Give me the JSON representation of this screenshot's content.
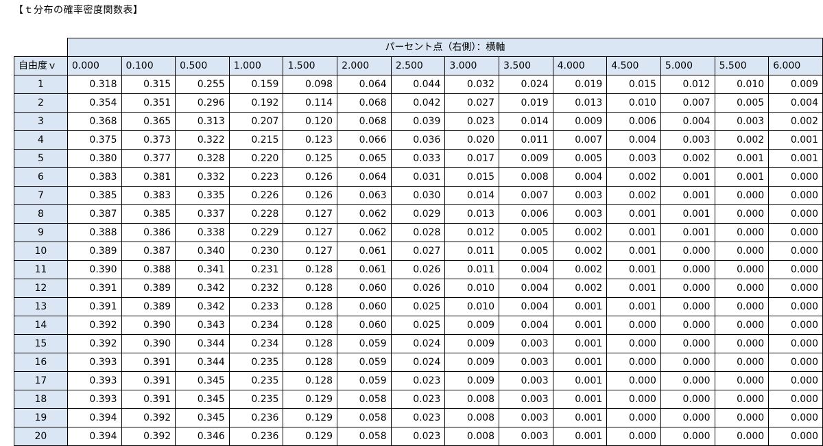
{
  "title": "【ｔ分布の確率密度関数表】",
  "table": {
    "header_span": "パーセント点（右側）：横軸",
    "row_header_label": "自由度ｖ",
    "columns": [
      "0.000",
      "0.100",
      "0.500",
      "1.000",
      "1.500",
      "2.000",
      "2.500",
      "3.000",
      "3.500",
      "4.000",
      "4.500",
      "5.000",
      "5.500",
      "6.000"
    ],
    "rows": [
      {
        "label": "1",
        "values": [
          "0.318",
          "0.315",
          "0.255",
          "0.159",
          "0.098",
          "0.064",
          "0.044",
          "0.032",
          "0.024",
          "0.019",
          "0.015",
          "0.012",
          "0.010",
          "0.009"
        ]
      },
      {
        "label": "2",
        "values": [
          "0.354",
          "0.351",
          "0.296",
          "0.192",
          "0.114",
          "0.068",
          "0.042",
          "0.027",
          "0.019",
          "0.013",
          "0.010",
          "0.007",
          "0.005",
          "0.004"
        ]
      },
      {
        "label": "3",
        "values": [
          "0.368",
          "0.365",
          "0.313",
          "0.207",
          "0.120",
          "0.068",
          "0.039",
          "0.023",
          "0.014",
          "0.009",
          "0.006",
          "0.004",
          "0.003",
          "0.002"
        ]
      },
      {
        "label": "4",
        "values": [
          "0.375",
          "0.373",
          "0.322",
          "0.215",
          "0.123",
          "0.066",
          "0.036",
          "0.020",
          "0.011",
          "0.007",
          "0.004",
          "0.003",
          "0.002",
          "0.001"
        ]
      },
      {
        "label": "5",
        "values": [
          "0.380",
          "0.377",
          "0.328",
          "0.220",
          "0.125",
          "0.065",
          "0.033",
          "0.017",
          "0.009",
          "0.005",
          "0.003",
          "0.002",
          "0.001",
          "0.001"
        ]
      },
      {
        "label": "6",
        "values": [
          "0.383",
          "0.381",
          "0.332",
          "0.223",
          "0.126",
          "0.064",
          "0.031",
          "0.015",
          "0.008",
          "0.004",
          "0.002",
          "0.001",
          "0.001",
          "0.000"
        ]
      },
      {
        "label": "7",
        "values": [
          "0.385",
          "0.383",
          "0.335",
          "0.226",
          "0.126",
          "0.063",
          "0.030",
          "0.014",
          "0.007",
          "0.003",
          "0.002",
          "0.001",
          "0.000",
          "0.000"
        ]
      },
      {
        "label": "8",
        "values": [
          "0.387",
          "0.385",
          "0.337",
          "0.228",
          "0.127",
          "0.062",
          "0.029",
          "0.013",
          "0.006",
          "0.003",
          "0.001",
          "0.001",
          "0.000",
          "0.000"
        ]
      },
      {
        "label": "9",
        "values": [
          "0.388",
          "0.386",
          "0.338",
          "0.229",
          "0.127",
          "0.062",
          "0.028",
          "0.012",
          "0.005",
          "0.002",
          "0.001",
          "0.001",
          "0.000",
          "0.000"
        ]
      },
      {
        "label": "10",
        "values": [
          "0.389",
          "0.387",
          "0.340",
          "0.230",
          "0.127",
          "0.061",
          "0.027",
          "0.011",
          "0.005",
          "0.002",
          "0.001",
          "0.000",
          "0.000",
          "0.000"
        ]
      },
      {
        "label": "11",
        "values": [
          "0.390",
          "0.388",
          "0.341",
          "0.231",
          "0.128",
          "0.061",
          "0.026",
          "0.011",
          "0.004",
          "0.002",
          "0.001",
          "0.000",
          "0.000",
          "0.000"
        ]
      },
      {
        "label": "12",
        "values": [
          "0.391",
          "0.389",
          "0.342",
          "0.232",
          "0.128",
          "0.060",
          "0.026",
          "0.010",
          "0.004",
          "0.002",
          "0.001",
          "0.000",
          "0.000",
          "0.000"
        ]
      },
      {
        "label": "13",
        "values": [
          "0.391",
          "0.389",
          "0.342",
          "0.233",
          "0.128",
          "0.060",
          "0.025",
          "0.010",
          "0.004",
          "0.001",
          "0.001",
          "0.000",
          "0.000",
          "0.000"
        ]
      },
      {
        "label": "14",
        "values": [
          "0.392",
          "0.390",
          "0.343",
          "0.234",
          "0.128",
          "0.060",
          "0.025",
          "0.009",
          "0.004",
          "0.001",
          "0.000",
          "0.000",
          "0.000",
          "0.000"
        ]
      },
      {
        "label": "15",
        "values": [
          "0.392",
          "0.390",
          "0.344",
          "0.234",
          "0.128",
          "0.059",
          "0.024",
          "0.009",
          "0.003",
          "0.001",
          "0.000",
          "0.000",
          "0.000",
          "0.000"
        ]
      },
      {
        "label": "16",
        "values": [
          "0.393",
          "0.391",
          "0.344",
          "0.235",
          "0.128",
          "0.059",
          "0.024",
          "0.009",
          "0.003",
          "0.001",
          "0.000",
          "0.000",
          "0.000",
          "0.000"
        ]
      },
      {
        "label": "17",
        "values": [
          "0.393",
          "0.391",
          "0.345",
          "0.235",
          "0.128",
          "0.059",
          "0.023",
          "0.009",
          "0.003",
          "0.001",
          "0.000",
          "0.000",
          "0.000",
          "0.000"
        ]
      },
      {
        "label": "18",
        "values": [
          "0.393",
          "0.391",
          "0.345",
          "0.235",
          "0.129",
          "0.058",
          "0.023",
          "0.008",
          "0.003",
          "0.001",
          "0.000",
          "0.000",
          "0.000",
          "0.000"
        ]
      },
      {
        "label": "19",
        "values": [
          "0.394",
          "0.392",
          "0.345",
          "0.236",
          "0.129",
          "0.058",
          "0.023",
          "0.008",
          "0.003",
          "0.001",
          "0.000",
          "0.000",
          "0.000",
          "0.000"
        ]
      },
      {
        "label": "20",
        "values": [
          "0.394",
          "0.392",
          "0.346",
          "0.236",
          "0.129",
          "0.058",
          "0.023",
          "0.008",
          "0.003",
          "0.001",
          "0.000",
          "0.000",
          "0.000",
          "0.000"
        ]
      }
    ]
  },
  "colors": {
    "header_fill": "#dae6f3",
    "border": "#000000"
  }
}
